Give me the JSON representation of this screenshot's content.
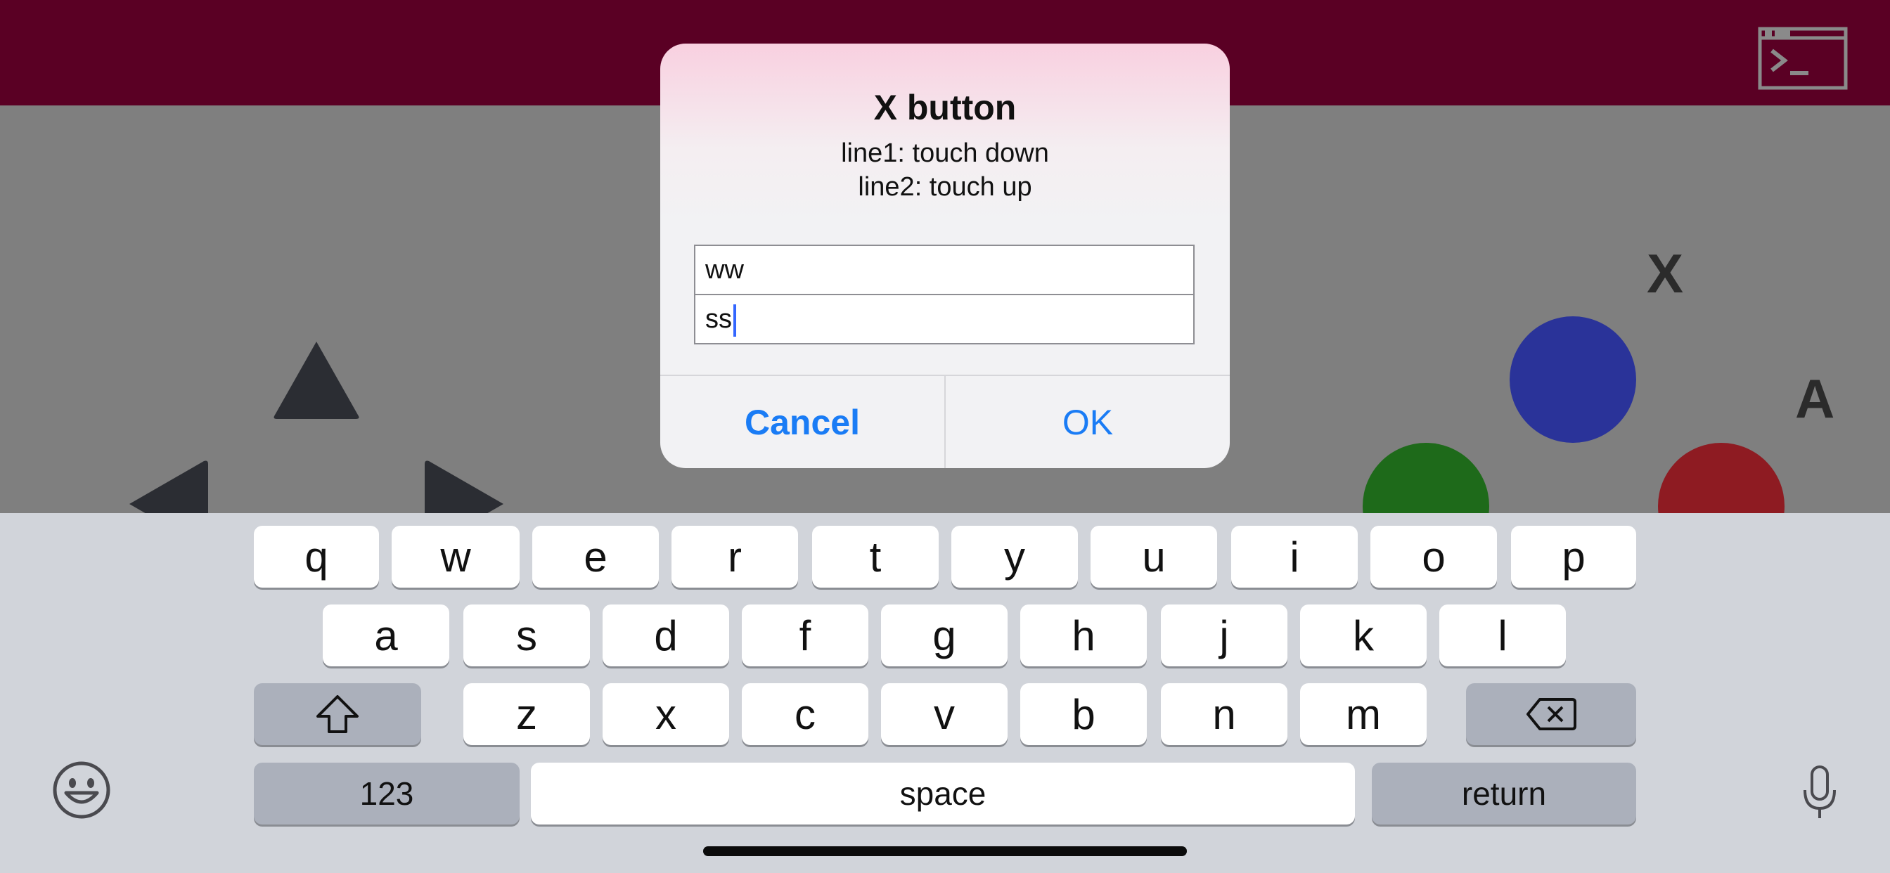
{
  "top_bar": {
    "terminal_icon": "terminal-icon",
    "color": "#5a0024"
  },
  "game": {
    "dpad_icons": [
      "triangle-up-icon",
      "triangle-left-icon",
      "triangle-right-icon"
    ],
    "buttons": [
      {
        "name": "blue",
        "color": "#2a3399"
      },
      {
        "name": "green",
        "color": "#1e6a1a"
      },
      {
        "name": "red",
        "color": "#8e1b22"
      }
    ],
    "labels": {
      "x": "X",
      "a": "A"
    }
  },
  "alert": {
    "title": "X button",
    "message_line1": "line1: touch down",
    "message_line2": "line2: touch up",
    "field1_value": "ww",
    "field2_value": "ss",
    "cancel_label": "Cancel",
    "ok_label": "OK",
    "accent": "#1a7cf5"
  },
  "keyboard": {
    "row1": [
      "q",
      "w",
      "e",
      "r",
      "t",
      "y",
      "u",
      "i",
      "o",
      "p"
    ],
    "row2": [
      "a",
      "s",
      "d",
      "f",
      "g",
      "h",
      "j",
      "k",
      "l"
    ],
    "row3": [
      "z",
      "x",
      "c",
      "v",
      "b",
      "n",
      "m"
    ],
    "shift_icon": "shift-icon",
    "delete_icon": "delete-icon",
    "numbers_label": "123",
    "space_label": "space",
    "return_label": "return",
    "emoji_icon": "emoji-icon",
    "mic_icon": "microphone-icon"
  }
}
